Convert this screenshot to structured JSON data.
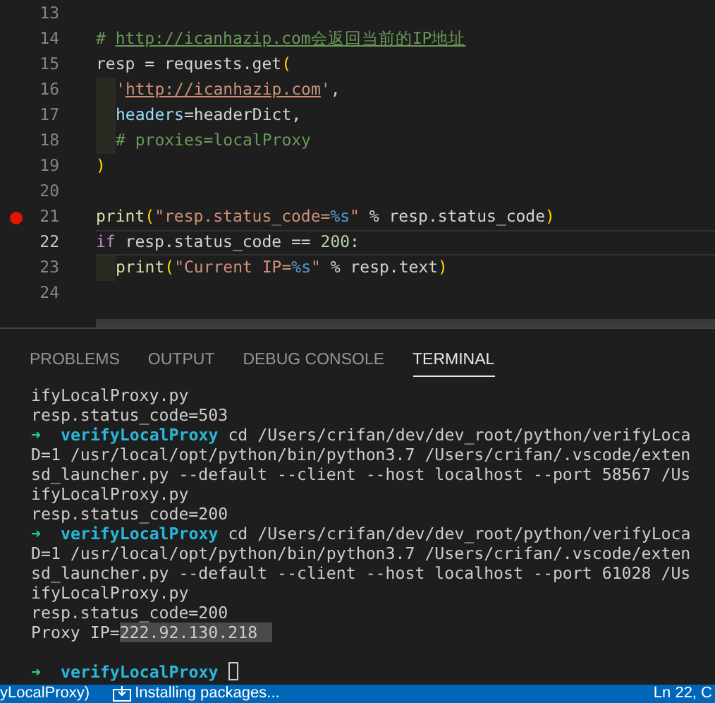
{
  "editor": {
    "lines": [
      {
        "number": "13",
        "indented": false,
        "current": false,
        "breakpoint": false
      },
      {
        "number": "14",
        "indented": false,
        "current": false,
        "breakpoint": false,
        "tokens": [
          {
            "kind": "comment",
            "text": "# "
          },
          {
            "kind": "comment-link",
            "text": "http://icanhazip.com会返回当前的IP地址"
          }
        ]
      },
      {
        "number": "15",
        "indented": false,
        "current": false,
        "breakpoint": false,
        "tokens": [
          {
            "kind": "plain",
            "text": "resp = requests.get"
          },
          {
            "kind": "paren",
            "text": "("
          }
        ]
      },
      {
        "number": "16",
        "indented": true,
        "current": false,
        "breakpoint": false,
        "tokens": [
          {
            "kind": "string",
            "text": "'"
          },
          {
            "kind": "string-link",
            "text": "http://icanhazip.com"
          },
          {
            "kind": "string",
            "text": "'"
          },
          {
            "kind": "plain",
            "text": ","
          }
        ]
      },
      {
        "number": "17",
        "indented": true,
        "current": false,
        "breakpoint": false,
        "tokens": [
          {
            "kind": "param",
            "text": "headers"
          },
          {
            "kind": "plain",
            "text": "=headerDict,"
          }
        ]
      },
      {
        "number": "18",
        "indented": true,
        "current": false,
        "breakpoint": false,
        "tokens": [
          {
            "kind": "comment",
            "text": "# proxies=localProxy"
          }
        ]
      },
      {
        "number": "19",
        "indented": false,
        "current": false,
        "breakpoint": false,
        "tokens": [
          {
            "kind": "paren",
            "text": ")"
          }
        ]
      },
      {
        "number": "20",
        "indented": false,
        "current": false,
        "breakpoint": false
      },
      {
        "number": "21",
        "indented": false,
        "current": false,
        "breakpoint": true,
        "tokens": [
          {
            "kind": "function",
            "text": "print"
          },
          {
            "kind": "paren",
            "text": "("
          },
          {
            "kind": "string",
            "text": "\"resp.status_code="
          },
          {
            "kind": "format",
            "text": "%s"
          },
          {
            "kind": "string",
            "text": "\""
          },
          {
            "kind": "plain",
            "text": " % resp.status_code"
          },
          {
            "kind": "paren",
            "text": ")"
          }
        ]
      },
      {
        "number": "22",
        "indented": false,
        "current": true,
        "breakpoint": false,
        "tokens": [
          {
            "kind": "keyword",
            "text": "if"
          },
          {
            "kind": "plain",
            "text": " resp.status_code == "
          },
          {
            "kind": "number",
            "text": "200"
          },
          {
            "kind": "plain",
            "text": ":"
          }
        ]
      },
      {
        "number": "23",
        "indented": true,
        "current": false,
        "breakpoint": false,
        "tokens": [
          {
            "kind": "function",
            "text": "print"
          },
          {
            "kind": "paren",
            "text": "("
          },
          {
            "kind": "string",
            "text": "\"Current IP="
          },
          {
            "kind": "format",
            "text": "%s"
          },
          {
            "kind": "string",
            "text": "\""
          },
          {
            "kind": "plain",
            "text": " % resp.text"
          },
          {
            "kind": "paren",
            "text": ")"
          }
        ]
      },
      {
        "number": "24",
        "indented": false,
        "current": false,
        "breakpoint": false
      }
    ]
  },
  "panel": {
    "tabs": [
      {
        "label": "PROBLEMS",
        "selected": false
      },
      {
        "label": "OUTPUT",
        "selected": false
      },
      {
        "label": "DEBUG CONSOLE",
        "selected": false
      },
      {
        "label": "TERMINAL",
        "selected": true
      }
    ],
    "terminal": [
      {
        "kind": "output",
        "segments": [
          {
            "text": "ifyLocalProxy.py",
            "selected": false
          }
        ]
      },
      {
        "kind": "output",
        "segments": [
          {
            "text": "resp.status_code=503",
            "selected": false
          }
        ]
      },
      {
        "kind": "prompt",
        "arrow": "➜",
        "dir": "verifyLocalProxy",
        "command": "cd /Users/crifan/dev/dev_root/python/verifyLoca",
        "cursor": false
      },
      {
        "kind": "output",
        "segments": [
          {
            "text": "D=1 /usr/local/opt/python/bin/python3.7 /Users/crifan/.vscode/exten",
            "selected": false
          }
        ]
      },
      {
        "kind": "output",
        "segments": [
          {
            "text": "sd_launcher.py --default --client --host localhost --port 58567 /Us",
            "selected": false
          }
        ]
      },
      {
        "kind": "output",
        "segments": [
          {
            "text": "ifyLocalProxy.py",
            "selected": false
          }
        ]
      },
      {
        "kind": "output",
        "segments": [
          {
            "text": "resp.status_code=200",
            "selected": false
          }
        ]
      },
      {
        "kind": "prompt",
        "arrow": "➜",
        "dir": "verifyLocalProxy",
        "command": "cd /Users/crifan/dev/dev_root/python/verifyLoca",
        "cursor": false
      },
      {
        "kind": "output",
        "segments": [
          {
            "text": "D=1 /usr/local/opt/python/bin/python3.7 /Users/crifan/.vscode/exten",
            "selected": false
          }
        ]
      },
      {
        "kind": "output",
        "segments": [
          {
            "text": "sd_launcher.py --default --client --host localhost --port 61028 /Us",
            "selected": false
          }
        ]
      },
      {
        "kind": "output",
        "segments": [
          {
            "text": "ifyLocalProxy.py",
            "selected": false
          }
        ]
      },
      {
        "kind": "output",
        "segments": [
          {
            "text": "resp.status_code=200",
            "selected": false
          }
        ]
      },
      {
        "kind": "output",
        "segments": [
          {
            "text": "Proxy IP=",
            "selected": false
          },
          {
            "text": "222.92.130.218",
            "selected": true
          }
        ]
      },
      {
        "kind": "blank"
      },
      {
        "kind": "prompt",
        "arrow": "➜",
        "dir": "verifyLocalProxy",
        "cursor": true
      }
    ]
  },
  "status_bar": {
    "left": "yLocalProxy)",
    "task": "Installing packages...",
    "right": "Ln 22, C"
  }
}
